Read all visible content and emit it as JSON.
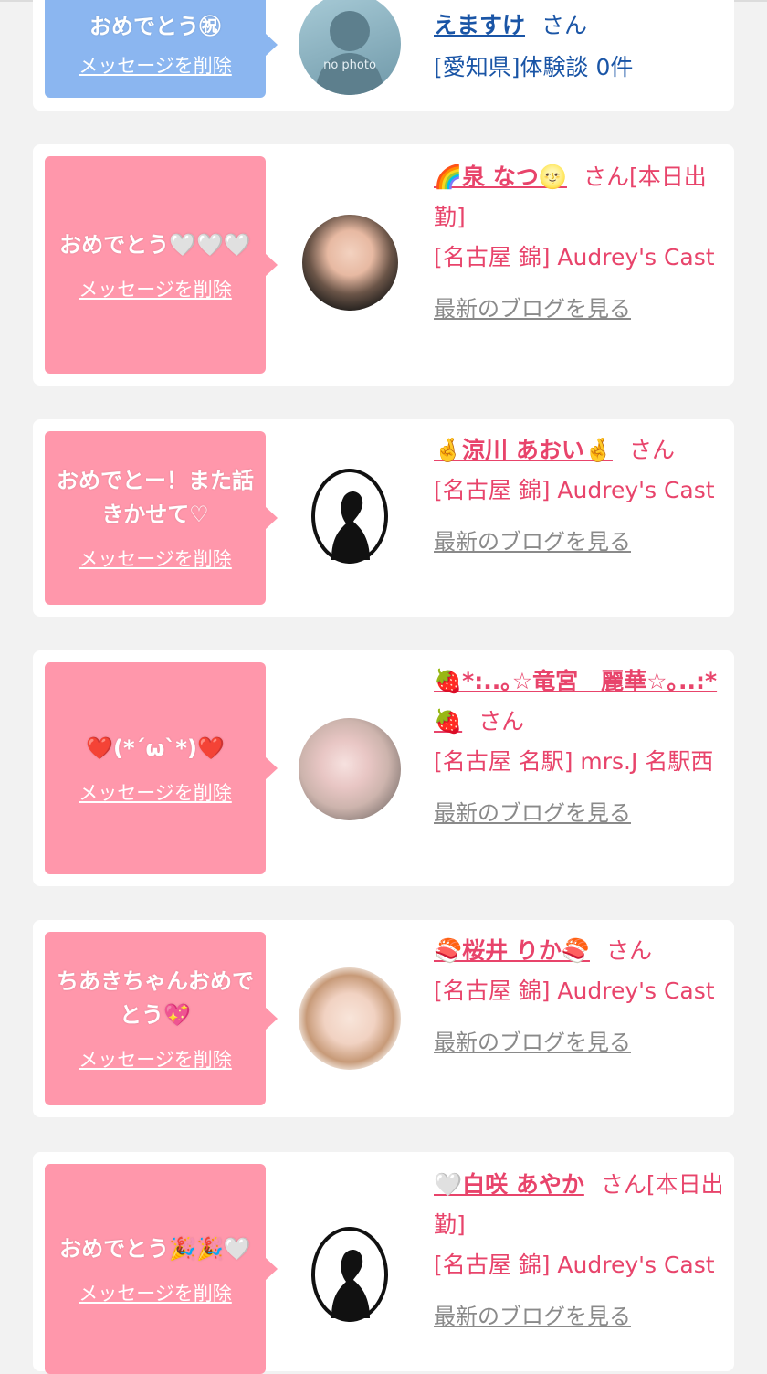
{
  "colors": {
    "accent_pink": "#e8446b",
    "bubble_pink": "#ff97ab",
    "bubble_blue": "#8bb6f0",
    "link_blue": "#1a55a6",
    "muted": "#8a8a8a"
  },
  "common": {
    "delete_label": "メッセージを削除",
    "blog_label": "最新のブログを見る"
  },
  "cards": [
    {
      "message": "おめでとう㊗",
      "name": "えますけ",
      "suffix": "さん",
      "line1": "[愛知県]体験談 0件",
      "line2": "",
      "avatar_label": "no photo"
    },
    {
      "message": "おめでとう🤍🤍🤍",
      "name": "🌈泉 なつ🌝",
      "suffix": "さん[本日出勤]",
      "line1": "[名古屋 錦] Audrey's Cast",
      "line2": ""
    },
    {
      "message": "おめでとー！また話きかせて♡",
      "name": "🤞涼川 あおい🤞",
      "suffix": "さん",
      "line1": "[名古屋 錦] Audrey's Cast",
      "line2": ""
    },
    {
      "message": "❤️(*´ω`*)❤️",
      "name": "🍓*:..｡☆竜宮　麗華☆｡..:*🍓",
      "suffix": "さん",
      "line1": "[名古屋 名駅] mrs.J 名駅西",
      "line2": ""
    },
    {
      "message": "ちあきちゃんおめでとう💖",
      "name": "🍣桜井 りか🍣",
      "suffix": "さん",
      "line1": "[名古屋 錦] Audrey's Cast",
      "line2": ""
    },
    {
      "message": "おめでとう🎉🎉🤍",
      "name": "🤍白咲 あやか",
      "suffix": "さん[本日出勤]",
      "line1": "[名古屋 錦] Audrey's Cast",
      "line2": ""
    }
  ]
}
